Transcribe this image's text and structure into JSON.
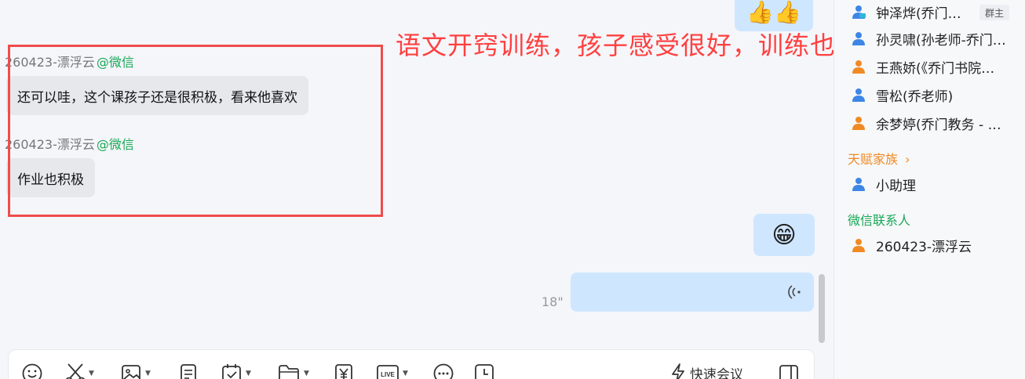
{
  "annotation": {
    "text": "语文开窍训练，孩子感受很好，训练也很积极"
  },
  "messages": [
    {
      "sender": "260423-漂浮云",
      "source": "@微信",
      "text": "还可以哇，这个课孩子还是很积极，看来他喜欢"
    },
    {
      "sender": "260423-漂浮云",
      "source": "@微信",
      "text": "作业也积极"
    }
  ],
  "right_bubbles": {
    "top_emoji": "👍👍",
    "grin_emoji": "😁",
    "voice_duration": "18\""
  },
  "sidebar": {
    "members": [
      {
        "name": "钟泽烨(乔门…",
        "badge": "群主",
        "color": "#3d86e6"
      },
      {
        "name": "孙灵啸(孙老师-乔门…",
        "color": "#3d86e6"
      },
      {
        "name": "王燕娇(《乔门书院…",
        "color": "#f08a24"
      },
      {
        "name": "雪松(乔老师)",
        "color": "#3d86e6"
      },
      {
        "name": "余梦婷(乔门教务 - …",
        "color": "#f08a24"
      }
    ],
    "sections": [
      {
        "label": "天赋家族",
        "color": "#f08a24",
        "members": [
          {
            "name": "小助理",
            "color": "#3d86e6"
          }
        ]
      },
      {
        "label": "微信联系人",
        "color": "#19a856",
        "members": [
          {
            "name": "260423-漂浮云",
            "color": "#f08a24"
          }
        ]
      }
    ]
  },
  "toolbar": {
    "items": [
      "emoji-icon",
      "scissors-icon",
      "image-icon",
      "document-icon",
      "calendar-check-icon",
      "folder-icon",
      "yuan-icon",
      "live-icon",
      "more-icon",
      "clock-icon"
    ],
    "live_label": "LIVE",
    "quick_meeting_label": "快速会议"
  }
}
